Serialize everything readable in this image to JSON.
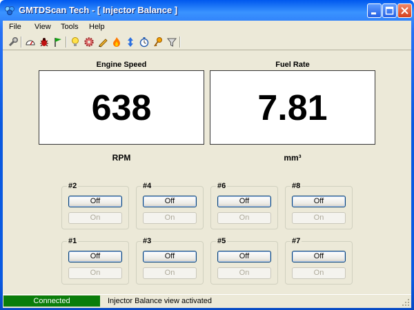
{
  "window": {
    "title": "GMTDScan Tech - [ Injector Balance ]"
  },
  "menu": [
    "File",
    "View",
    "Tools",
    "Help"
  ],
  "toolbar_icons": [
    "wrench-icon",
    "gauge-icon",
    "bug-icon",
    "flag-icon",
    "bulb-icon",
    "gear-icon",
    "pencil-icon",
    "flame-icon",
    "arrows-icon",
    "timer-icon",
    "key-icon",
    "funnel-icon"
  ],
  "engine": {
    "label": "Engine Speed",
    "value": "638",
    "unit": "RPM"
  },
  "fuel": {
    "label": "Fuel Rate",
    "value": "7.81",
    "unit": "mm³"
  },
  "injectors": {
    "off_label": "Off",
    "on_label": "On",
    "top_row": [
      "#2",
      "#4",
      "#6",
      "#8"
    ],
    "bottom_row": [
      "#1",
      "#3",
      "#5",
      "#7"
    ]
  },
  "status": {
    "connection": "Connected",
    "message": "Injector Balance view activated",
    "connection_color": "#0a7d0a"
  }
}
